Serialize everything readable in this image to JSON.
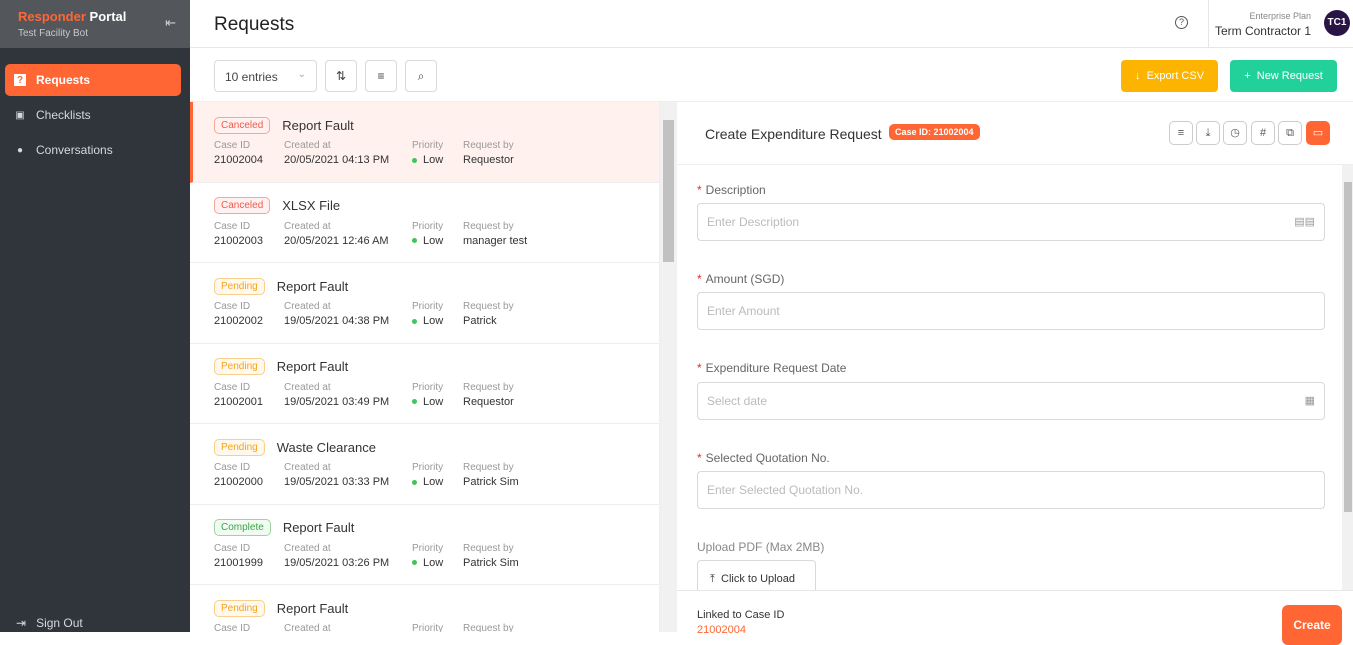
{
  "sidebar": {
    "brand_a": "Responder",
    "brand_b": "Portal",
    "subtitle": "Test Facility Bot",
    "items": [
      {
        "label": "Requests"
      },
      {
        "label": "Checklists"
      },
      {
        "label": "Conversations"
      }
    ],
    "signout": "Sign Out"
  },
  "header": {
    "title": "Requests",
    "plan": "Enterprise Plan",
    "user": "Term Contractor 1",
    "avatar": "TC1"
  },
  "toolbar": {
    "entries": "10 entries",
    "export": "Export CSV",
    "new_request": "New Request"
  },
  "labels": {
    "case_id": "Case ID",
    "created": "Created at",
    "priority": "Priority",
    "request_by": "Request by"
  },
  "requests": [
    {
      "status": "Canceled",
      "title": "Report Fault",
      "case_id": "21002004",
      "created": "20/05/2021 04:13 PM",
      "priority": "Low",
      "by": "Requestor"
    },
    {
      "status": "Canceled",
      "title": "XLSX File",
      "case_id": "21002003",
      "created": "20/05/2021 12:46 AM",
      "priority": "Low",
      "by": "manager test"
    },
    {
      "status": "Pending",
      "title": "Report Fault",
      "case_id": "21002002",
      "created": "19/05/2021 04:38 PM",
      "priority": "Low",
      "by": "Patrick"
    },
    {
      "status": "Pending",
      "title": "Report Fault",
      "case_id": "21002001",
      "created": "19/05/2021 03:49 PM",
      "priority": "Low",
      "by": "Requestor"
    },
    {
      "status": "Pending",
      "title": "Waste Clearance",
      "case_id": "21002000",
      "created": "19/05/2021 03:33 PM",
      "priority": "Low",
      "by": "Patrick Sim"
    },
    {
      "status": "Complete",
      "title": "Report Fault",
      "case_id": "21001999",
      "created": "19/05/2021 03:26 PM",
      "priority": "Low",
      "by": "Patrick Sim"
    },
    {
      "status": "Pending",
      "title": "Report Fault",
      "case_id": "",
      "created": "",
      "priority": "",
      "by": ""
    }
  ],
  "detail": {
    "title": "Create Expenditure Request",
    "case_badge": "Case ID: 21002004",
    "fields": [
      {
        "label": "Description",
        "placeholder": "Enter Description"
      },
      {
        "label": "Amount (SGD)",
        "placeholder": "Enter Amount"
      },
      {
        "label": "Expenditure Request Date",
        "placeholder": "Select date"
      },
      {
        "label": "Selected Quotation No.",
        "placeholder": "Enter Selected Quotation No."
      }
    ],
    "upload_label": "Upload PDF (Max 2MB)",
    "upload_button": "Click to Upload",
    "linked_label": "Linked to Case ID",
    "linked_id": "21002004",
    "create": "Create"
  }
}
